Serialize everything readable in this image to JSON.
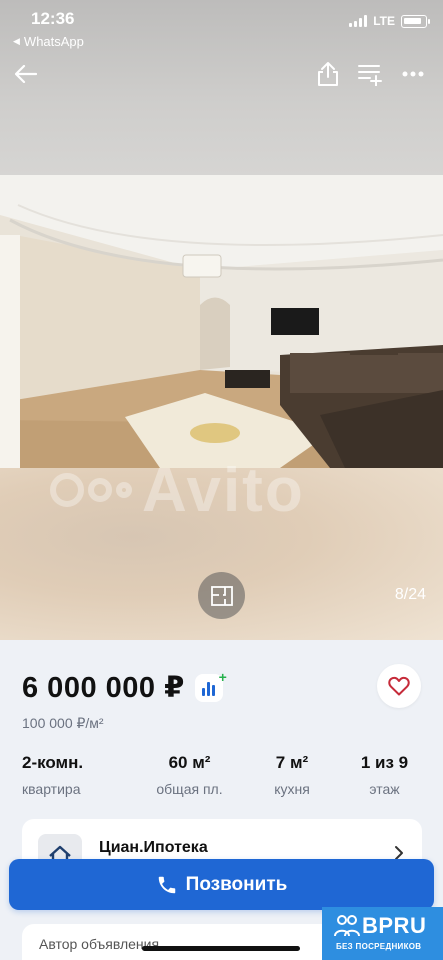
{
  "status_bar": {
    "time": "12:36",
    "back_app": "WhatsApp",
    "network": "LTE"
  },
  "toolbar": {
    "back_icon": "arrow-left-icon",
    "share_icon": "share-icon",
    "compare_icon": "add-to-list-icon",
    "more_icon": "more-horizontal-icon"
  },
  "gallery": {
    "watermark": "Avito",
    "counter": "8/24",
    "floorplan_icon": "floorplan-icon"
  },
  "listing": {
    "price": "6 000 000 ₽",
    "price_per_m2": "100 000 ₽/м²",
    "params": [
      {
        "value": "2-комн.",
        "label": "квартира"
      },
      {
        "value": "60 м²",
        "label": "общая пл."
      },
      {
        "value": "7 м²",
        "label": "кухня"
      },
      {
        "value": "1 из 9",
        "label": "этаж"
      }
    ]
  },
  "mortgage": {
    "title": "Циан.Ипотека"
  },
  "call_button": {
    "label": "Позвонить"
  },
  "author": {
    "label": "Автор объявления"
  },
  "badge": {
    "brand": "BPRU",
    "subtitle": "БЕЗ ПОСРЕДНИКОВ"
  },
  "colors": {
    "accent": "#1f67d4",
    "favorite": "#c62b3a",
    "badge": "#2e8ee0"
  }
}
